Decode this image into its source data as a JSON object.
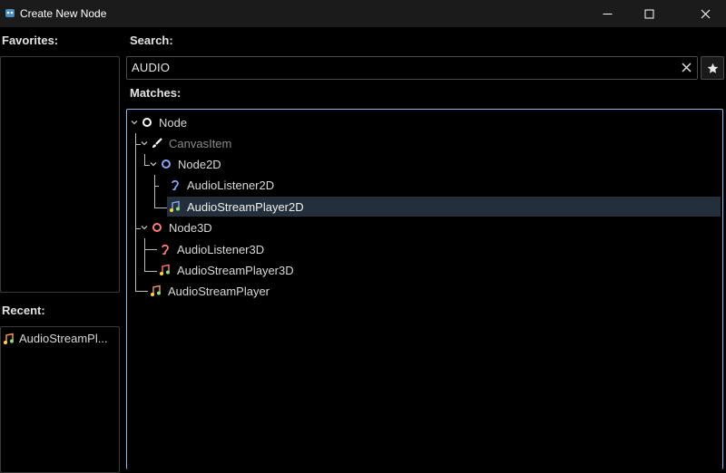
{
  "window": {
    "title": "Create New Node"
  },
  "favorites": {
    "label": "Favorites:"
  },
  "recent": {
    "label": "Recent:",
    "items": [
      {
        "label": "AudioStreamPl...",
        "icon": "audio-stream-player-icon"
      }
    ]
  },
  "search": {
    "label": "Search:",
    "value": "AUDIO"
  },
  "matches": {
    "label": "Matches:",
    "items": [
      {
        "label": "Node",
        "icon": "node-icon"
      },
      {
        "label": "CanvasItem",
        "icon": "canvas-item-icon"
      },
      {
        "label": "Node2D",
        "icon": "node2d-icon"
      },
      {
        "label": "AudioListener2D",
        "icon": "audio-listener-2d-icon"
      },
      {
        "label": "AudioStreamPlayer2D",
        "icon": "audio-stream-player-2d-icon",
        "selected": true
      },
      {
        "label": "Node3D",
        "icon": "node3d-icon"
      },
      {
        "label": "AudioListener3D",
        "icon": "audio-listener-3d-icon"
      },
      {
        "label": "AudioStreamPlayer3D",
        "icon": "audio-stream-player-3d-icon"
      },
      {
        "label": "AudioStreamPlayer",
        "icon": "audio-stream-player-icon"
      }
    ]
  },
  "colors": {
    "selection": "#23303b",
    "focus_border": "#8fb6e6",
    "node2d": "#8da5f3",
    "node3d": "#fc7f7f"
  }
}
